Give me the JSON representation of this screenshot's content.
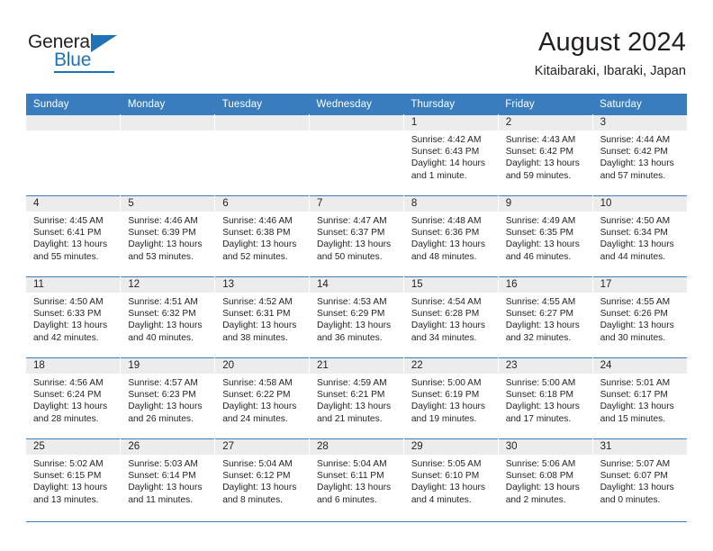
{
  "brand": {
    "name_part1": "General",
    "name_part2": "Blue",
    "accent_color": "#1f72b8"
  },
  "header": {
    "title": "August 2024",
    "subtitle": "Kitaibaraki, Ibaraki, Japan"
  },
  "calendar": {
    "header_bg": "#3a7dbf",
    "daynum_bg": "#ececec",
    "weekdays": [
      "Sunday",
      "Monday",
      "Tuesday",
      "Wednesday",
      "Thursday",
      "Friday",
      "Saturday"
    ],
    "weeks": [
      [
        {
          "day": "",
          "lines": []
        },
        {
          "day": "",
          "lines": []
        },
        {
          "day": "",
          "lines": []
        },
        {
          "day": "",
          "lines": []
        },
        {
          "day": "1",
          "lines": [
            "Sunrise: 4:42 AM",
            "Sunset: 6:43 PM",
            "Daylight: 14 hours",
            "and 1 minute."
          ]
        },
        {
          "day": "2",
          "lines": [
            "Sunrise: 4:43 AM",
            "Sunset: 6:42 PM",
            "Daylight: 13 hours",
            "and 59 minutes."
          ]
        },
        {
          "day": "3",
          "lines": [
            "Sunrise: 4:44 AM",
            "Sunset: 6:42 PM",
            "Daylight: 13 hours",
            "and 57 minutes."
          ]
        }
      ],
      [
        {
          "day": "4",
          "lines": [
            "Sunrise: 4:45 AM",
            "Sunset: 6:41 PM",
            "Daylight: 13 hours",
            "and 55 minutes."
          ]
        },
        {
          "day": "5",
          "lines": [
            "Sunrise: 4:46 AM",
            "Sunset: 6:39 PM",
            "Daylight: 13 hours",
            "and 53 minutes."
          ]
        },
        {
          "day": "6",
          "lines": [
            "Sunrise: 4:46 AM",
            "Sunset: 6:38 PM",
            "Daylight: 13 hours",
            "and 52 minutes."
          ]
        },
        {
          "day": "7",
          "lines": [
            "Sunrise: 4:47 AM",
            "Sunset: 6:37 PM",
            "Daylight: 13 hours",
            "and 50 minutes."
          ]
        },
        {
          "day": "8",
          "lines": [
            "Sunrise: 4:48 AM",
            "Sunset: 6:36 PM",
            "Daylight: 13 hours",
            "and 48 minutes."
          ]
        },
        {
          "day": "9",
          "lines": [
            "Sunrise: 4:49 AM",
            "Sunset: 6:35 PM",
            "Daylight: 13 hours",
            "and 46 minutes."
          ]
        },
        {
          "day": "10",
          "lines": [
            "Sunrise: 4:50 AM",
            "Sunset: 6:34 PM",
            "Daylight: 13 hours",
            "and 44 minutes."
          ]
        }
      ],
      [
        {
          "day": "11",
          "lines": [
            "Sunrise: 4:50 AM",
            "Sunset: 6:33 PM",
            "Daylight: 13 hours",
            "and 42 minutes."
          ]
        },
        {
          "day": "12",
          "lines": [
            "Sunrise: 4:51 AM",
            "Sunset: 6:32 PM",
            "Daylight: 13 hours",
            "and 40 minutes."
          ]
        },
        {
          "day": "13",
          "lines": [
            "Sunrise: 4:52 AM",
            "Sunset: 6:31 PM",
            "Daylight: 13 hours",
            "and 38 minutes."
          ]
        },
        {
          "day": "14",
          "lines": [
            "Sunrise: 4:53 AM",
            "Sunset: 6:29 PM",
            "Daylight: 13 hours",
            "and 36 minutes."
          ]
        },
        {
          "day": "15",
          "lines": [
            "Sunrise: 4:54 AM",
            "Sunset: 6:28 PM",
            "Daylight: 13 hours",
            "and 34 minutes."
          ]
        },
        {
          "day": "16",
          "lines": [
            "Sunrise: 4:55 AM",
            "Sunset: 6:27 PM",
            "Daylight: 13 hours",
            "and 32 minutes."
          ]
        },
        {
          "day": "17",
          "lines": [
            "Sunrise: 4:55 AM",
            "Sunset: 6:26 PM",
            "Daylight: 13 hours",
            "and 30 minutes."
          ]
        }
      ],
      [
        {
          "day": "18",
          "lines": [
            "Sunrise: 4:56 AM",
            "Sunset: 6:24 PM",
            "Daylight: 13 hours",
            "and 28 minutes."
          ]
        },
        {
          "day": "19",
          "lines": [
            "Sunrise: 4:57 AM",
            "Sunset: 6:23 PM",
            "Daylight: 13 hours",
            "and 26 minutes."
          ]
        },
        {
          "day": "20",
          "lines": [
            "Sunrise: 4:58 AM",
            "Sunset: 6:22 PM",
            "Daylight: 13 hours",
            "and 24 minutes."
          ]
        },
        {
          "day": "21",
          "lines": [
            "Sunrise: 4:59 AM",
            "Sunset: 6:21 PM",
            "Daylight: 13 hours",
            "and 21 minutes."
          ]
        },
        {
          "day": "22",
          "lines": [
            "Sunrise: 5:00 AM",
            "Sunset: 6:19 PM",
            "Daylight: 13 hours",
            "and 19 minutes."
          ]
        },
        {
          "day": "23",
          "lines": [
            "Sunrise: 5:00 AM",
            "Sunset: 6:18 PM",
            "Daylight: 13 hours",
            "and 17 minutes."
          ]
        },
        {
          "day": "24",
          "lines": [
            "Sunrise: 5:01 AM",
            "Sunset: 6:17 PM",
            "Daylight: 13 hours",
            "and 15 minutes."
          ]
        }
      ],
      [
        {
          "day": "25",
          "lines": [
            "Sunrise: 5:02 AM",
            "Sunset: 6:15 PM",
            "Daylight: 13 hours",
            "and 13 minutes."
          ]
        },
        {
          "day": "26",
          "lines": [
            "Sunrise: 5:03 AM",
            "Sunset: 6:14 PM",
            "Daylight: 13 hours",
            "and 11 minutes."
          ]
        },
        {
          "day": "27",
          "lines": [
            "Sunrise: 5:04 AM",
            "Sunset: 6:12 PM",
            "Daylight: 13 hours",
            "and 8 minutes."
          ]
        },
        {
          "day": "28",
          "lines": [
            "Sunrise: 5:04 AM",
            "Sunset: 6:11 PM",
            "Daylight: 13 hours",
            "and 6 minutes."
          ]
        },
        {
          "day": "29",
          "lines": [
            "Sunrise: 5:05 AM",
            "Sunset: 6:10 PM",
            "Daylight: 13 hours",
            "and 4 minutes."
          ]
        },
        {
          "day": "30",
          "lines": [
            "Sunrise: 5:06 AM",
            "Sunset: 6:08 PM",
            "Daylight: 13 hours",
            "and 2 minutes."
          ]
        },
        {
          "day": "31",
          "lines": [
            "Sunrise: 5:07 AM",
            "Sunset: 6:07 PM",
            "Daylight: 13 hours",
            "and 0 minutes."
          ]
        }
      ]
    ]
  }
}
